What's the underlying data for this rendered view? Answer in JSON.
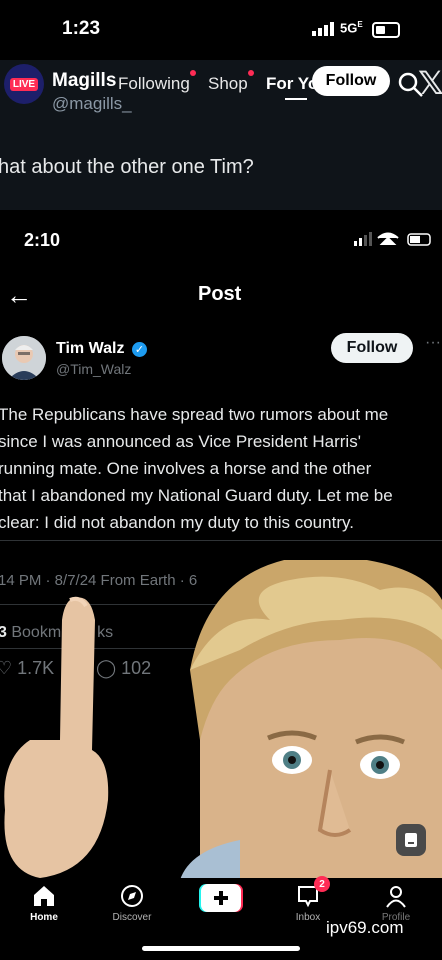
{
  "status_bar": {
    "time": "1:23",
    "network": "5G",
    "network_superscript": "E"
  },
  "tiktok_top": {
    "live_badge": "LIVE",
    "tabs": [
      {
        "label": "Following"
      },
      {
        "label": "Shop"
      },
      {
        "label": "For Yo"
      }
    ],
    "follow_label": "Follow"
  },
  "outer_tweet": {
    "author": "Magills",
    "handle": "@magills_",
    "text": "hat about the other one Tim?"
  },
  "inner_post": {
    "time": "2:10",
    "header_title": "Post",
    "author": "Tim Walz",
    "handle": "@Tim_Walz",
    "follow_label": "Follow",
    "body_lines": [
      "The Republicans have spread two rumors about me",
      "since I was announced as Vice President Harris'",
      "running mate. One involves a horse and the other",
      "that I abandoned my National Guard duty. Let me be",
      "clear: I did not abandon my duty to this country."
    ],
    "meta": "14 PM · 8/7/24 From Earth · 6",
    "bookmarks_count": "3",
    "bookmarks_label": "Bookm",
    "bookmarks_label_end": "ks",
    "likes": "1.7K",
    "replies": "102"
  },
  "bottom_nav": {
    "items": [
      {
        "label": "Home"
      },
      {
        "label": "Discover"
      },
      {
        "label": ""
      },
      {
        "label": "Inbox",
        "badge": "2"
      },
      {
        "label": "Profile"
      }
    ]
  },
  "watermark": "ipv69.com",
  "colors": {
    "accent": "#ff2c55",
    "verified": "#1d9bf0",
    "cyan": "#25f4ee"
  }
}
